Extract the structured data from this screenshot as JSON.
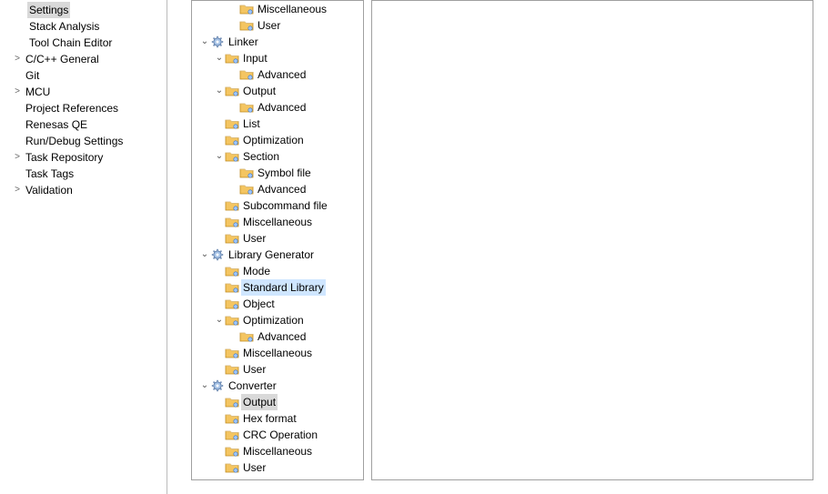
{
  "left_panel": {
    "items": [
      {
        "label": "Settings",
        "indent": true,
        "arrow": "",
        "selected": true
      },
      {
        "label": "Stack Analysis",
        "indent": true,
        "arrow": "",
        "selected": false
      },
      {
        "label": "Tool Chain Editor",
        "indent": true,
        "arrow": "",
        "selected": false
      },
      {
        "label": "C/C++ General",
        "indent": false,
        "arrow": ">",
        "selected": false
      },
      {
        "label": "Git",
        "indent": false,
        "arrow": "",
        "selected": false
      },
      {
        "label": "MCU",
        "indent": false,
        "arrow": ">",
        "selected": false
      },
      {
        "label": "Project References",
        "indent": false,
        "arrow": "",
        "selected": false
      },
      {
        "label": "Renesas QE",
        "indent": false,
        "arrow": "",
        "selected": false
      },
      {
        "label": "Run/Debug Settings",
        "indent": false,
        "arrow": "",
        "selected": false
      },
      {
        "label": "Task Repository",
        "indent": false,
        "arrow": ">",
        "selected": false
      },
      {
        "label": "Task Tags",
        "indent": false,
        "arrow": "",
        "selected": false
      },
      {
        "label": "Validation",
        "indent": false,
        "arrow": ">",
        "selected": false
      }
    ]
  },
  "tree": [
    {
      "level": 2,
      "twisty": "",
      "icon": "folder",
      "label": "Miscellaneous",
      "state": ""
    },
    {
      "level": 2,
      "twisty": "",
      "icon": "folder",
      "label": "User",
      "state": ""
    },
    {
      "level": 0,
      "twisty": "v",
      "icon": "gear",
      "label": "Linker",
      "state": ""
    },
    {
      "level": 1,
      "twisty": "v",
      "icon": "folder",
      "label": "Input",
      "state": ""
    },
    {
      "level": 2,
      "twisty": "",
      "icon": "folder",
      "label": "Advanced",
      "state": ""
    },
    {
      "level": 1,
      "twisty": "v",
      "icon": "folder",
      "label": "Output",
      "state": ""
    },
    {
      "level": 2,
      "twisty": "",
      "icon": "folder",
      "label": "Advanced",
      "state": ""
    },
    {
      "level": 1,
      "twisty": "",
      "icon": "folder",
      "label": "List",
      "state": ""
    },
    {
      "level": 1,
      "twisty": "",
      "icon": "folder",
      "label": "Optimization",
      "state": ""
    },
    {
      "level": 1,
      "twisty": "v",
      "icon": "folder",
      "label": "Section",
      "state": ""
    },
    {
      "level": 2,
      "twisty": "",
      "icon": "folder",
      "label": "Symbol file",
      "state": ""
    },
    {
      "level": 2,
      "twisty": "",
      "icon": "folder",
      "label": "Advanced",
      "state": ""
    },
    {
      "level": 1,
      "twisty": "",
      "icon": "folder",
      "label": "Subcommand file",
      "state": ""
    },
    {
      "level": 1,
      "twisty": "",
      "icon": "folder",
      "label": "Miscellaneous",
      "state": ""
    },
    {
      "level": 1,
      "twisty": "",
      "icon": "folder",
      "label": "User",
      "state": ""
    },
    {
      "level": 0,
      "twisty": "v",
      "icon": "gear",
      "label": "Library Generator",
      "state": ""
    },
    {
      "level": 1,
      "twisty": "",
      "icon": "folder",
      "label": "Mode",
      "state": ""
    },
    {
      "level": 1,
      "twisty": "",
      "icon": "folder",
      "label": "Standard Library",
      "state": "hov"
    },
    {
      "level": 1,
      "twisty": "",
      "icon": "folder",
      "label": "Object",
      "state": ""
    },
    {
      "level": 1,
      "twisty": "v",
      "icon": "folder",
      "label": "Optimization",
      "state": ""
    },
    {
      "level": 2,
      "twisty": "",
      "icon": "folder",
      "label": "Advanced",
      "state": ""
    },
    {
      "level": 1,
      "twisty": "",
      "icon": "folder",
      "label": "Miscellaneous",
      "state": ""
    },
    {
      "level": 1,
      "twisty": "",
      "icon": "folder",
      "label": "User",
      "state": ""
    },
    {
      "level": 0,
      "twisty": "v",
      "icon": "gear",
      "label": "Converter",
      "state": ""
    },
    {
      "level": 1,
      "twisty": "",
      "icon": "folder",
      "label": "Output",
      "state": "sel"
    },
    {
      "level": 1,
      "twisty": "",
      "icon": "folder",
      "label": "Hex format",
      "state": ""
    },
    {
      "level": 1,
      "twisty": "",
      "icon": "folder",
      "label": "CRC Operation",
      "state": ""
    },
    {
      "level": 1,
      "twisty": "",
      "icon": "folder",
      "label": "Miscellaneous",
      "state": ""
    },
    {
      "level": 1,
      "twisty": "",
      "icon": "folder",
      "label": "User",
      "state": ""
    }
  ]
}
